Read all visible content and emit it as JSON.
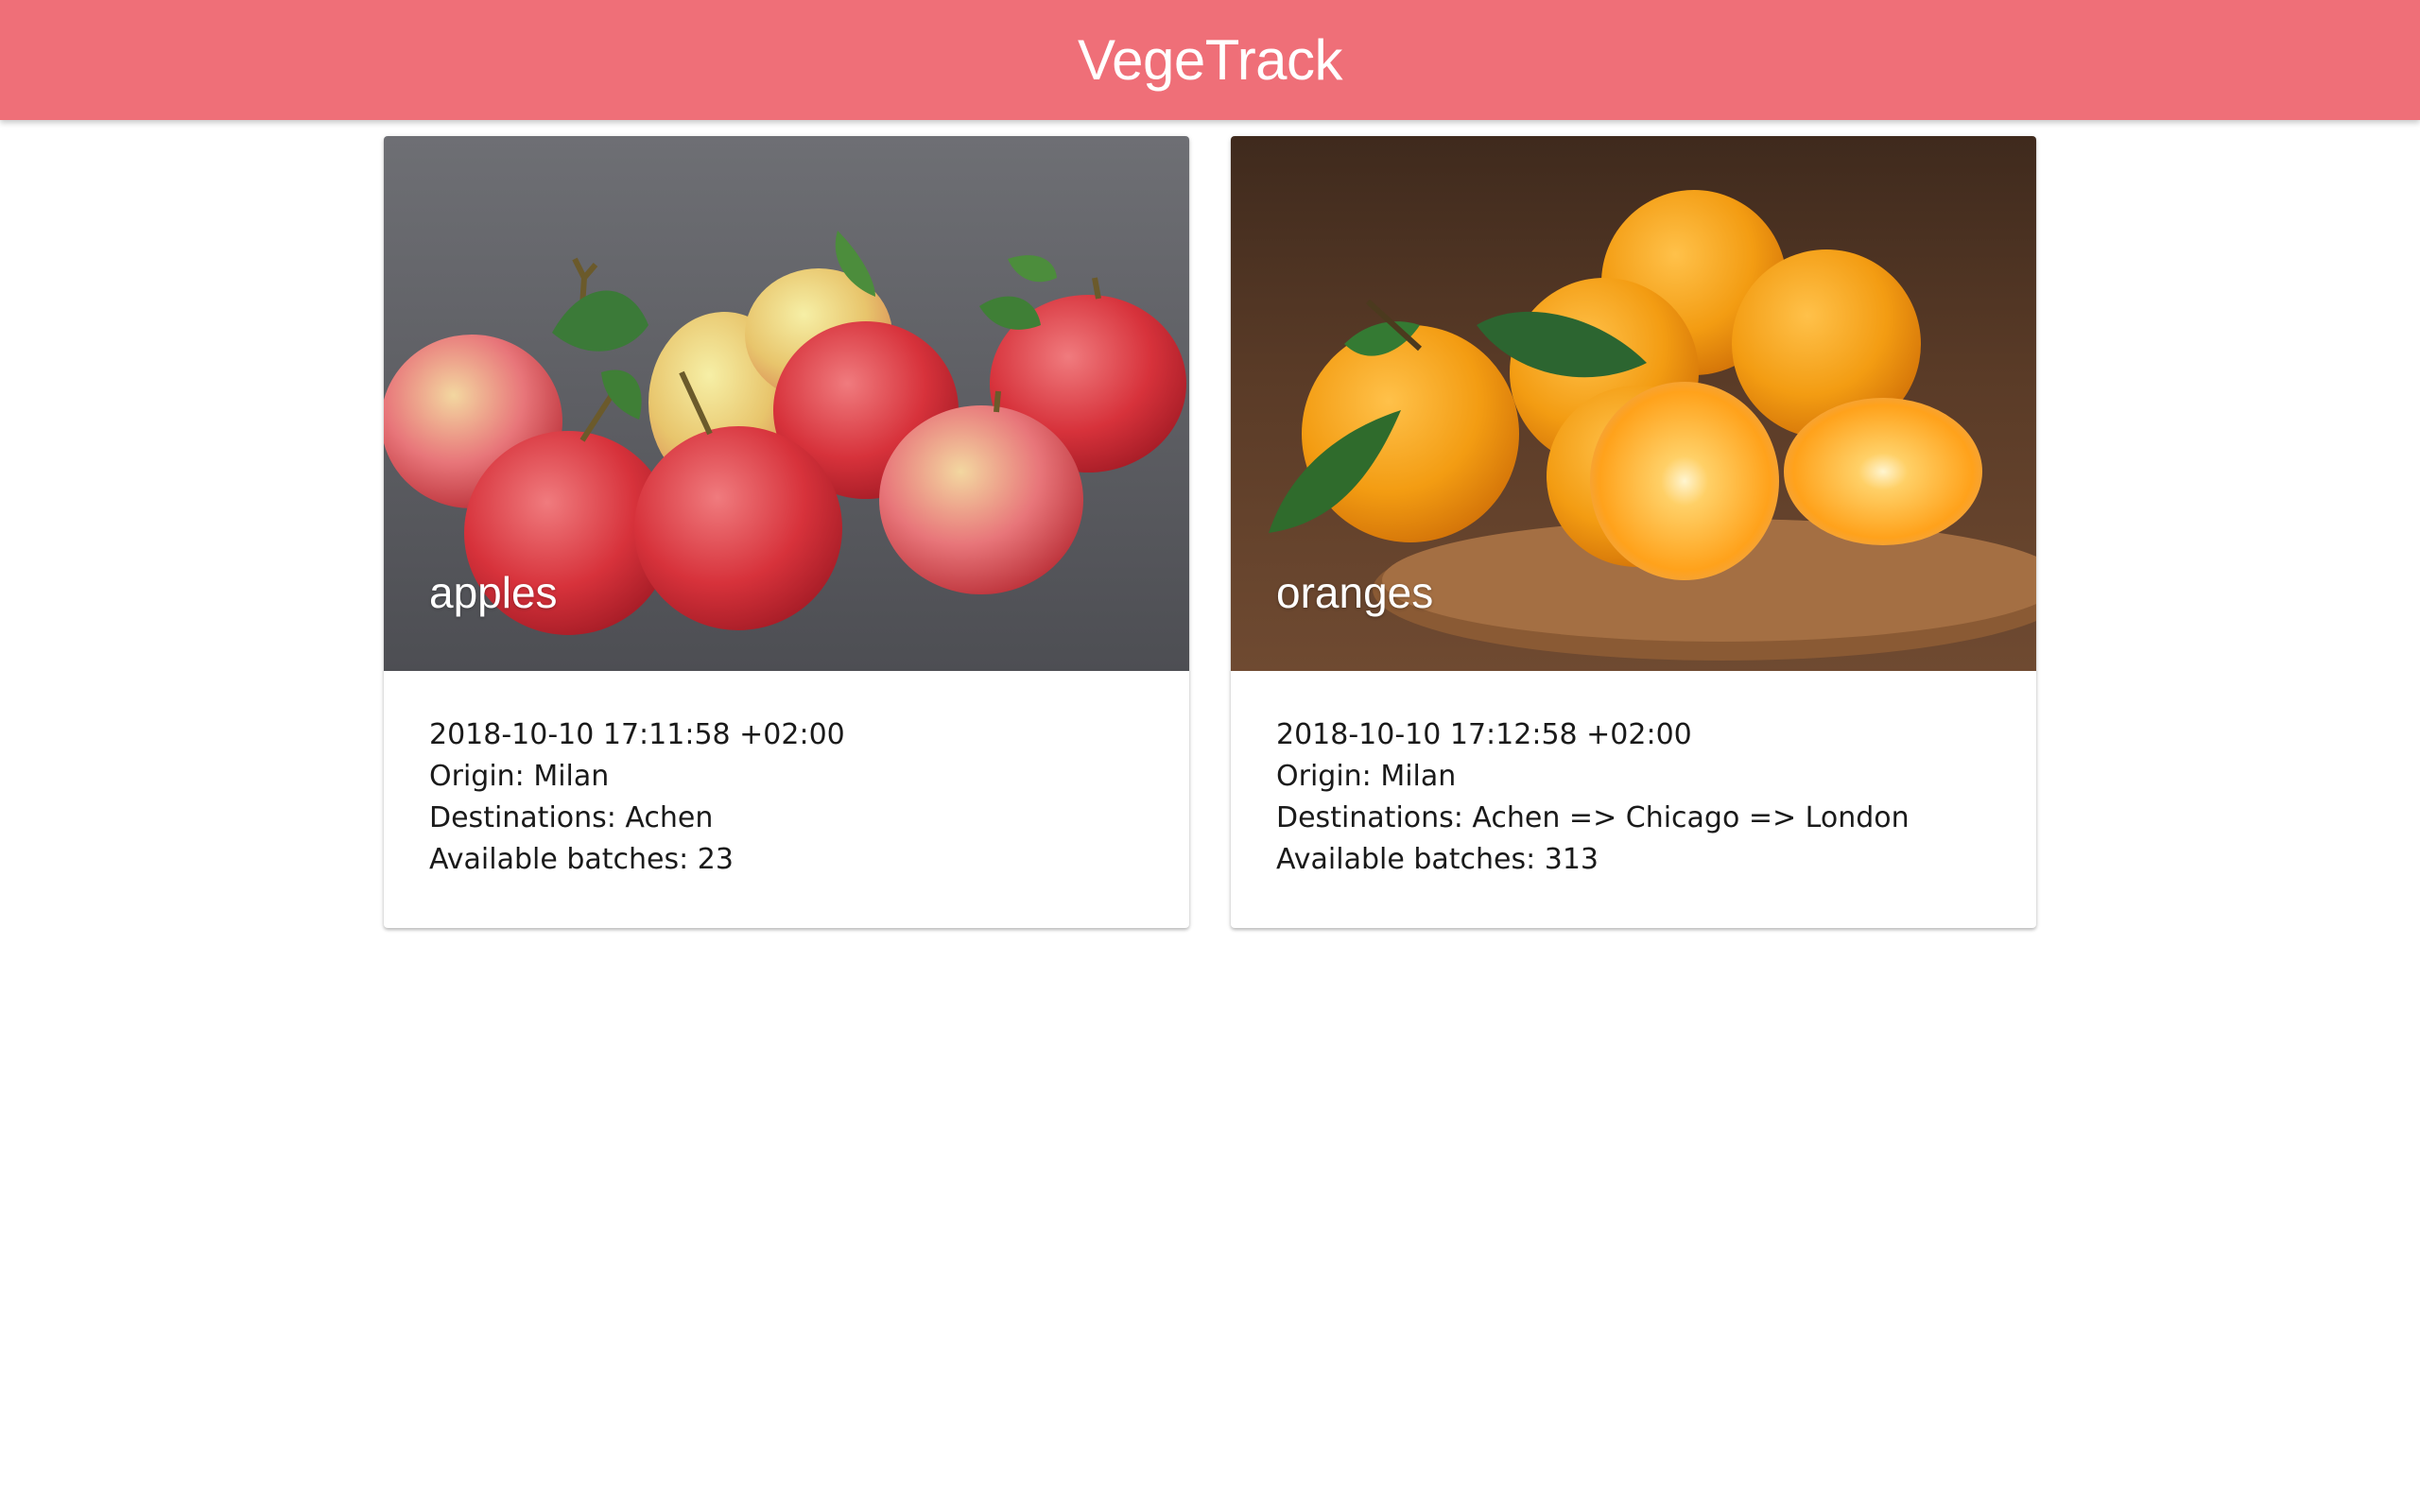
{
  "app": {
    "title": "VegeTrack",
    "bar_color": "#ef6f78"
  },
  "cards": [
    {
      "name": "apples",
      "image": "apples-photo",
      "timestamp": "2018-10-10 17:11:58 +02:00",
      "origin": "Origin: Milan",
      "destinations": "Destinations: Achen",
      "batches": "Available batches: 23"
    },
    {
      "name": "oranges",
      "image": "oranges-photo",
      "timestamp": "2018-10-10 17:12:58 +02:00",
      "origin": "Origin: Milan",
      "destinations": "Destinations: Achen => Chicago => London",
      "batches": "Available batches: 313"
    }
  ]
}
